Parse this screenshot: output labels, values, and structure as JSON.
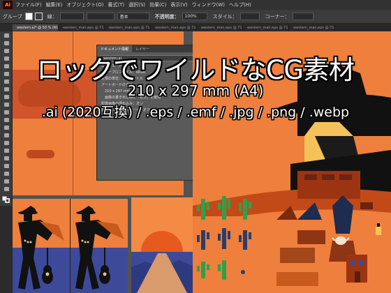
{
  "menubar": {
    "app_logo": "Ai",
    "items": [
      "ファイル(F)",
      "編集(E)",
      "オブジェクト(O)",
      "書式(T)",
      "選択(S)",
      "効果(C)",
      "表示(V)",
      "ウィンドウ(W)",
      "ヘルプ(H)"
    ]
  },
  "controlbar": {
    "group_label": "グループ",
    "stroke_label": "線：",
    "brush_label": "基本",
    "opacity_label": "不透明度：",
    "opacity_value": "100%",
    "style_label": "スタイル：",
    "corner_label": "コーナー："
  },
  "tabs": [
    "western.ai* @ 50 % (RGB/プレビュー)",
    "western_man.eps @ 71.76 % (RGB/プ...",
    "western_man.eps @ 71.76 % (RGB/プ...",
    "western_man.eps @ 71.76 % (RGB/プ...",
    "western_man.eps @ 71.76 % (RGB/プ...",
    "western_man.eps @ 71.76 % (RGB/プ...",
    "western_man.eps @ 71.76 % (RGB/プ..."
  ],
  "panel": {
    "tab_active": "ドキュメント情報",
    "tab_other": "レイヤー",
    "field_value": "western.ai",
    "rows": [
      "カラーモード：RGB",
      "カラープロファイル：sRGB",
      "定規の単位：ミリメートル",
      "アートボードの寸法：",
      "　210 x 297 mm",
      "　画像の書き出し時に「表示」を使用",
      "配置画像の埋め込み：オン",
      "複合パスのシミュレート：オフ"
    ]
  },
  "overlay": {
    "headline": "ロックでワイルドなCG素材",
    "size_line": "210 x 297 mm (A4)",
    "formats_line": ".ai (2020互換) / .eps / .emf / .jpg / .png / .webp"
  },
  "colors": {
    "orange_bg": "#ef7f3c",
    "dark_orange": "#d2542a",
    "navy": "#3d4a9a",
    "cactus_green": "#2fa04a",
    "cactus_navy": "#2b3e6b",
    "sun_orange": "#e65a1e",
    "skin": "#f5c25a"
  },
  "icons": [
    "selection-tool-icon",
    "direct-selection-icon",
    "pen-tool-icon",
    "type-tool-icon",
    "line-tool-icon",
    "rectangle-tool-icon",
    "brush-tool-icon",
    "pencil-tool-icon",
    "eraser-tool-icon",
    "rotate-tool-icon",
    "scale-tool-icon",
    "warp-tool-icon",
    "shape-builder-icon",
    "gradient-tool-icon",
    "eyedropper-tool-icon",
    "blend-tool-icon",
    "symbol-sprayer-icon",
    "graph-tool-icon",
    "artboard-tool-icon",
    "slice-tool-icon",
    "hand-tool-icon",
    "zoom-tool-icon"
  ]
}
